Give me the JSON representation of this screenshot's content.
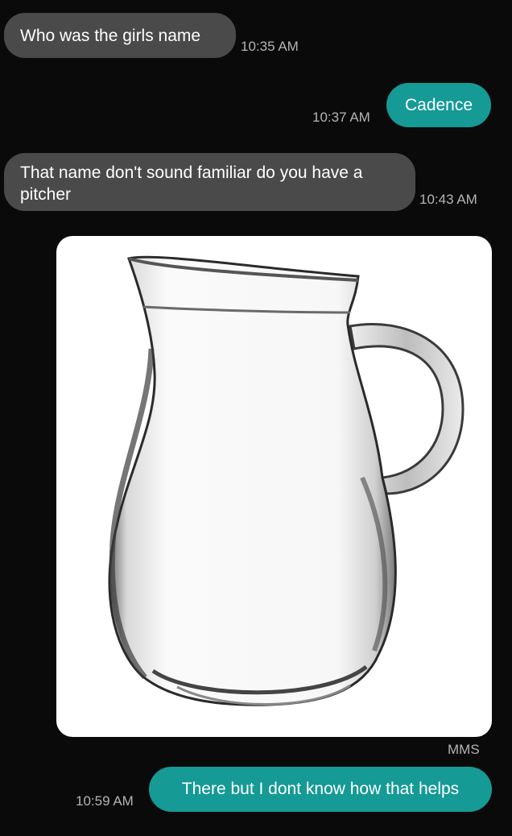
{
  "conversation": {
    "messages": [
      {
        "direction": "incoming",
        "text": "Who was the girls name",
        "time": "10:35 AM"
      },
      {
        "direction": "outgoing",
        "text": "Cadence",
        "time": "10:37 AM"
      },
      {
        "direction": "incoming",
        "text": "That name don't sound familiar do you have a pitcher",
        "time": "10:43 AM"
      },
      {
        "direction": "incoming",
        "type": "image",
        "image_subject": "glass-pitcher-photo",
        "label": "MMS"
      },
      {
        "direction": "outgoing",
        "text": "There but I dont know how that helps",
        "time": "10:59 AM"
      }
    ]
  },
  "colors": {
    "background": "#0a0a0a",
    "incoming_bubble": "#4a4a4a",
    "outgoing_bubble": "#159a96",
    "timestamp": "#b4b4b4"
  }
}
